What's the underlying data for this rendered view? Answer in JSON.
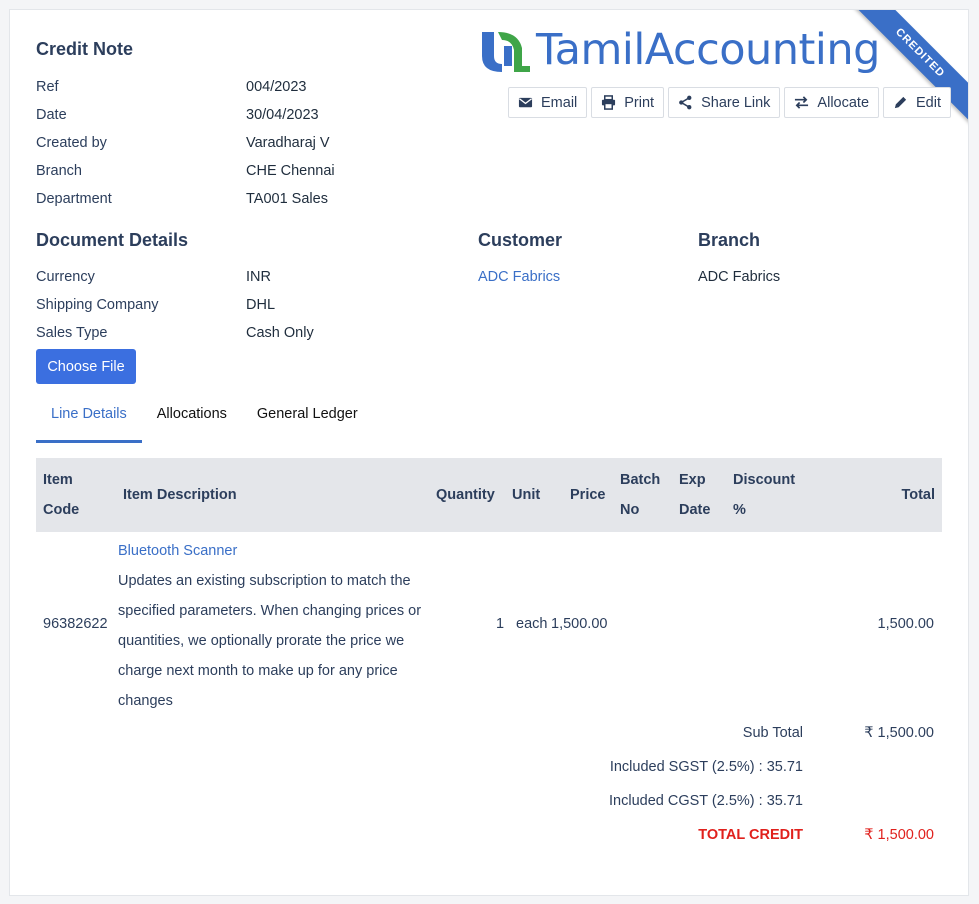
{
  "ribbon": "CREDITED",
  "logo": {
    "part1": "Tamil",
    "part2": "Accounting"
  },
  "title": "Credit Note",
  "header_fields": [
    {
      "label": "Ref",
      "value": "004/2023"
    },
    {
      "label": "Date",
      "value": "30/04/2023"
    },
    {
      "label": "Created by",
      "value": "Varadharaj V"
    },
    {
      "label": "Branch",
      "value": "CHE Chennai"
    },
    {
      "label": "Department",
      "value": "TA001 Sales"
    }
  ],
  "toolbar": {
    "email": "Email",
    "print": "Print",
    "share_link": "Share Link",
    "allocate": "Allocate",
    "edit": "Edit"
  },
  "document_details": {
    "heading": "Document Details",
    "fields": [
      {
        "label": "Currency",
        "value": "INR"
      },
      {
        "label": "Shipping Company",
        "value": "DHL"
      },
      {
        "label": "Sales Type",
        "value": "Cash Only"
      }
    ]
  },
  "customer": {
    "heading": "Customer",
    "name": "ADC Fabrics"
  },
  "branch": {
    "heading": "Branch",
    "name": "ADC Fabrics"
  },
  "choose_file": "Choose File",
  "tabs": [
    {
      "label": "Line Details",
      "active": true
    },
    {
      "label": "Allocations",
      "active": false
    },
    {
      "label": "General Ledger",
      "active": false
    }
  ],
  "table": {
    "columns": {
      "item_code_1": "Item",
      "item_code_2": "Code",
      "item_description": "Item Description",
      "quantity": "Quantity",
      "unit": "Unit",
      "price": "Price",
      "batch_1": "Batch",
      "batch_2": "No",
      "exp_1": "Exp",
      "exp_2": "Date",
      "discount_1": "Discount",
      "discount_2": "%",
      "total": "Total"
    },
    "rows": [
      {
        "item_code": "96382622",
        "item_name": "Bluetooth Scanner",
        "description": "Updates an existing subscription to match the specified parameters. When changing prices or quantities, we optionally prorate the price we charge next month to make up for any price changes",
        "quantity": "1",
        "unit": "each",
        "price": "1,500.00",
        "total": "1,500.00"
      }
    ]
  },
  "totals": {
    "sub_total_label": "Sub Total",
    "sub_total_value": "₹ 1,500.00",
    "sgst": "Included SGST (2.5%) : 35.71",
    "cgst": "Included CGST (2.5%) : 35.71",
    "total_credit_label": "TOTAL CREDIT",
    "total_credit_value": "₹ 1,500.00"
  },
  "colors": {
    "accent": "#3a6fc7",
    "primary_button": "#3b6fe0",
    "total_red": "#e0201c",
    "logo_green": "#3fa548"
  }
}
